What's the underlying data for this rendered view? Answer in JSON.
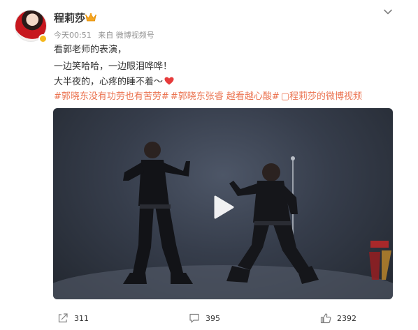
{
  "post": {
    "username": "程莉莎",
    "timestamp": "今天00:51",
    "source": "来自 微博视频号",
    "lines": [
      "看郭老师的表演，",
      "一边笑哈哈，一边眼泪哗哗！",
      "大半夜的，心疼的睡不着～"
    ],
    "tags": [
      "#郭晓东没有功劳也有苦劳#",
      "#郭晓东张睿 越看越心酸#",
      "▢程莉莎的微博视频"
    ],
    "accent_color": "#eb7350"
  },
  "actions": {
    "share_count": "311",
    "comment_count": "395",
    "like_count": "2392"
  },
  "icons": {
    "crown": "crown-icon",
    "more": "chevron-down-icon",
    "heart": "heart-icon",
    "play": "play-icon",
    "share": "share-icon",
    "comment": "comment-icon",
    "like": "like-icon"
  }
}
